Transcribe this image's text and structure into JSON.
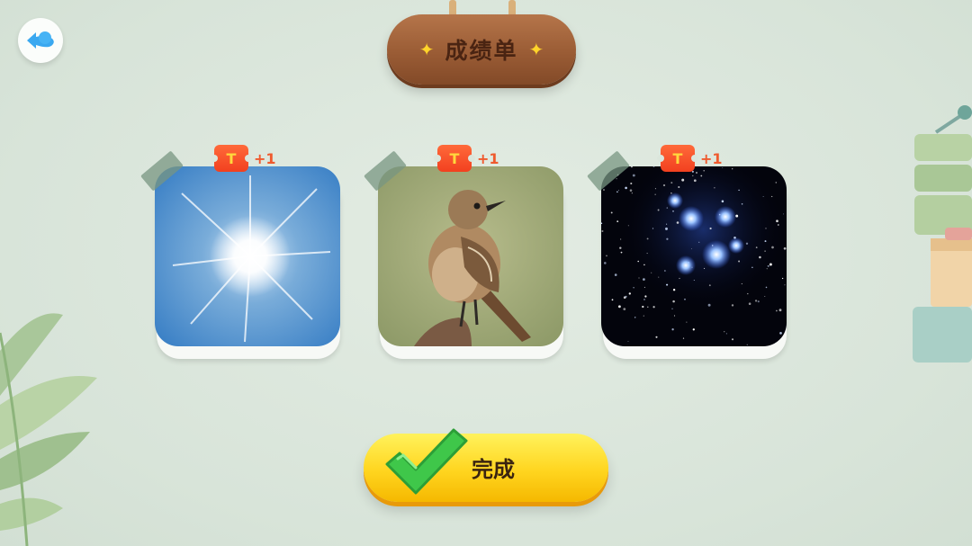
{
  "header": {
    "title": "成绩单",
    "sparkle_glyph": "✦"
  },
  "back_button": {
    "icon": "back-arrow-cloud-icon"
  },
  "cards": [
    {
      "subject": "sun",
      "ticket_glyph": "T",
      "reward": "+1"
    },
    {
      "subject": "bird",
      "ticket_glyph": "T",
      "reward": "+1"
    },
    {
      "subject": "stars",
      "ticket_glyph": "T",
      "reward": "+1"
    }
  ],
  "done_button": {
    "label": "完成",
    "icon": "checkmark-icon"
  },
  "colors": {
    "background": "#dbe6dc",
    "sign_wood": "#9a5c35",
    "button_yellow": "#ffd51f",
    "ticket_red": "#f2401f",
    "check_green": "#3fc74a"
  }
}
